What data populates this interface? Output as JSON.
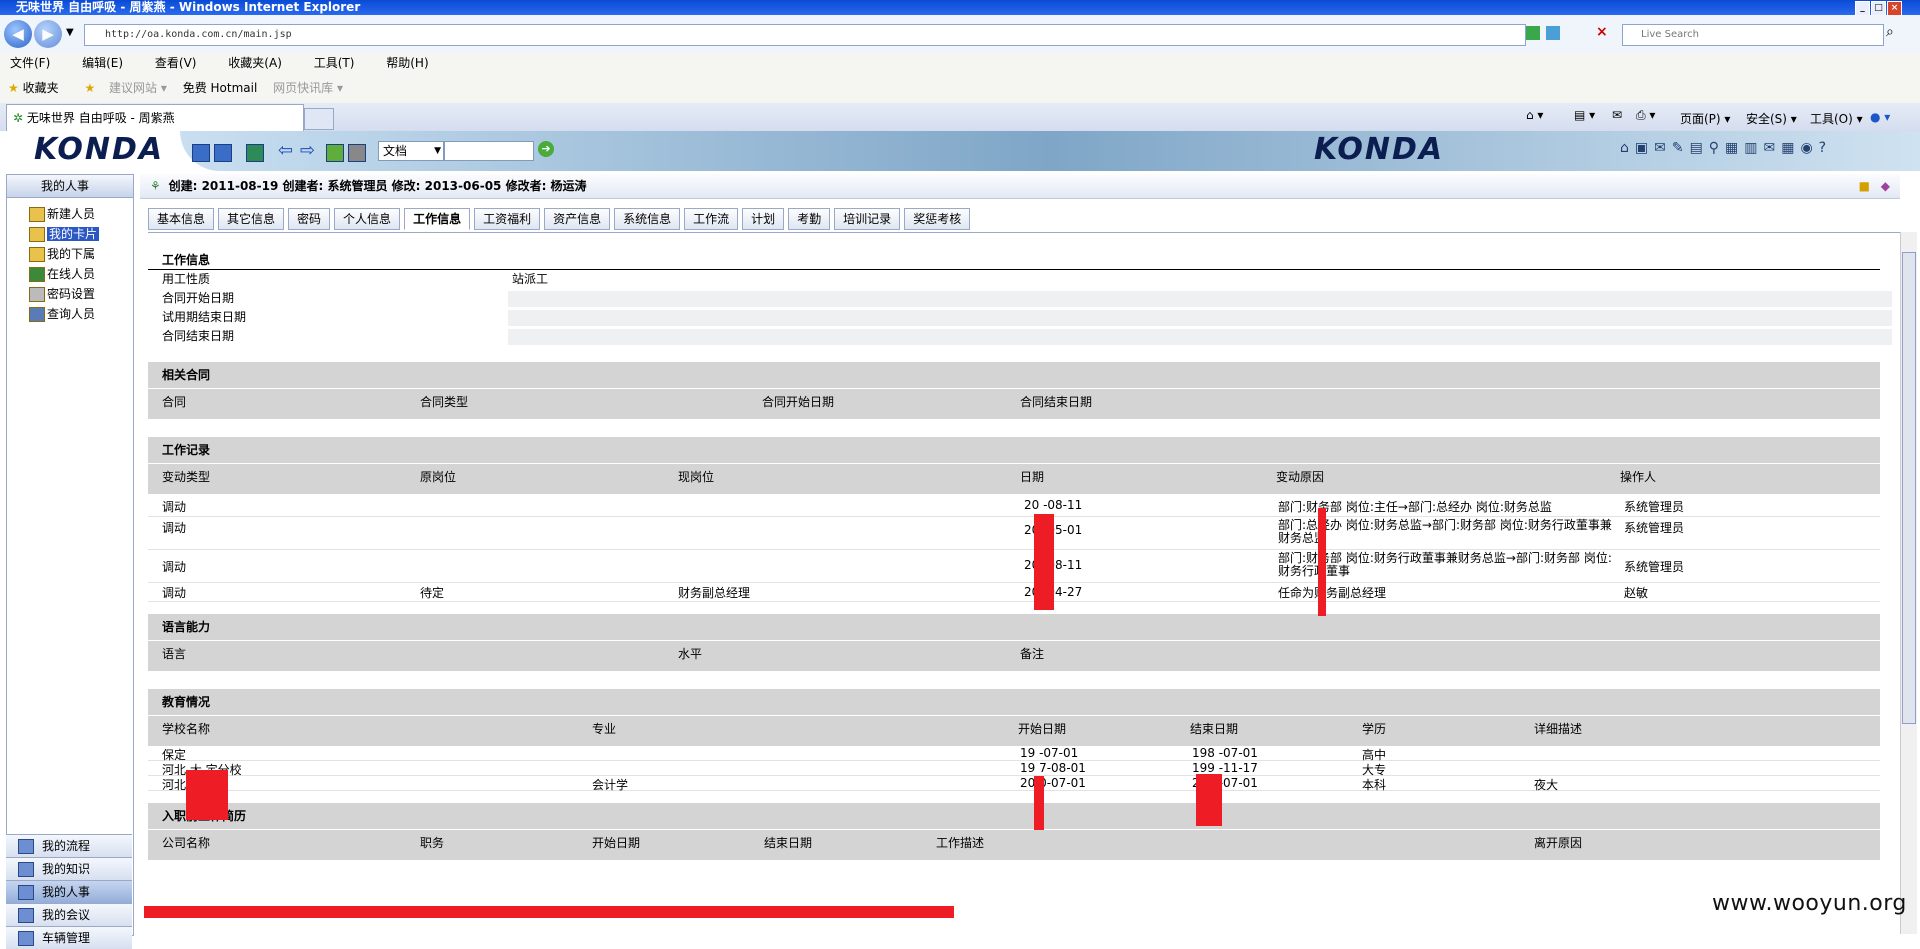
{
  "window": {
    "title": "无味世界 自由呼吸 - 周紫燕 - Windows Internet Explorer"
  },
  "browser": {
    "address": "http://oa.konda.com.cn/main.jsp",
    "search_placeholder": "Live Search",
    "menu": [
      "文件(F)",
      "编辑(E)",
      "查看(V)",
      "收藏夹(A)",
      "工具(T)",
      "帮助(H)"
    ],
    "favorites_label": "收藏夹",
    "fav_links": [
      "建议网站 ▾",
      "免费 Hotmail",
      "网页快讯库 ▾"
    ],
    "tab_title": "无味世界 自由呼吸 - 周紫燕",
    "cmd": [
      "页面(P) ▾",
      "安全(S) ▾",
      "工具(O) ▾"
    ]
  },
  "app": {
    "logo": "KONDA",
    "doc_select": "文档",
    "infobar": "创建: 2011-08-19  创建者: 系统管理员  修改: 2013-06-05  修改者: 杨运涛"
  },
  "sidebar": {
    "header": "我的人事",
    "items": [
      "新建人员",
      "我的卡片",
      "我的下属",
      "在线人员",
      "密码设置",
      "查询人员"
    ],
    "bottom": [
      "我的流程",
      "我的知识",
      "我的人事",
      "我的会议",
      "车辆管理"
    ]
  },
  "tabs": [
    "基本信息",
    "其它信息",
    "密码",
    "个人信息",
    "工作信息",
    "工资福利",
    "资产信息",
    "系统信息",
    "工作流",
    "计划",
    "考勤",
    "培训记录",
    "奖惩考核"
  ],
  "work_info": {
    "title": "工作信息",
    "fields": [
      {
        "k": "用工性质",
        "v": "站派工"
      },
      {
        "k": "合同开始日期",
        "v": ""
      },
      {
        "k": "试用期结束日期",
        "v": ""
      },
      {
        "k": "合同结束日期",
        "v": ""
      }
    ]
  },
  "contracts": {
    "title": "相关合同",
    "headers": [
      "合同",
      "合同类型",
      "合同开始日期",
      "合同结束日期"
    ]
  },
  "work_records": {
    "title": "工作记录",
    "headers": [
      "变动类型",
      "原岗位",
      "现岗位",
      "日期",
      "变动原因",
      "操作人"
    ],
    "rows": [
      {
        "type": "调动",
        "from": "",
        "to": "",
        "date": "20  -08-11",
        "reason": "部门:财务部 岗位:主任→部门:总经办 岗位:财务总监",
        "op": "系统管理员"
      },
      {
        "type": "调动",
        "from": "",
        "to": "",
        "date": "20  -05-01",
        "reason": "部门:总经办 岗位:财务总监→部门:财务部 岗位:财务行政董事兼财务总监",
        "op": "系统管理员"
      },
      {
        "type": "调动",
        "from": "",
        "to": "",
        "date": "20  -08-11",
        "reason": "部门:财务部 岗位:财务行政董事兼财务总监→部门:财务部 岗位:财务行政董事",
        "op": "系统管理员"
      },
      {
        "type": "调动",
        "from": "待定",
        "to": "财务副总经理",
        "date": "20  -04-27",
        "reason": "任命为财务副总经理",
        "op": "赵敏"
      }
    ]
  },
  "language": {
    "title": "语言能力",
    "headers": [
      "语言",
      "水平",
      "备注"
    ]
  },
  "education": {
    "title": "教育情况",
    "headers": [
      "学校名称",
      "专业",
      "开始日期",
      "结束日期",
      "学历",
      "详细描述"
    ],
    "rows": [
      {
        "school": "保定",
        "major": "",
        "start": "19  -07-01",
        "end": "198  -07-01",
        "degree": "高中",
        "desc": ""
      },
      {
        "school": "河北  大 定分校",
        "major": "",
        "start": "19  7-08-01",
        "end": "199  -11-17",
        "degree": "大专",
        "desc": ""
      },
      {
        "school": "河北",
        "major": "会计学",
        "start": "20  0-07-01",
        "end": "200  -07-01",
        "degree": "本科",
        "desc": "夜大"
      }
    ]
  },
  "prior_jobs": {
    "title": "入职前工作简历",
    "headers": [
      "公司名称",
      "职务",
      "开始日期",
      "结束日期",
      "工作描述",
      "离开原因"
    ]
  },
  "watermark": "www.wooyun.org",
  "colors": {
    "redaction": "#ee1c24",
    "section_bg": "#d4d4d4",
    "ie_title": "#0a4bd6"
  }
}
